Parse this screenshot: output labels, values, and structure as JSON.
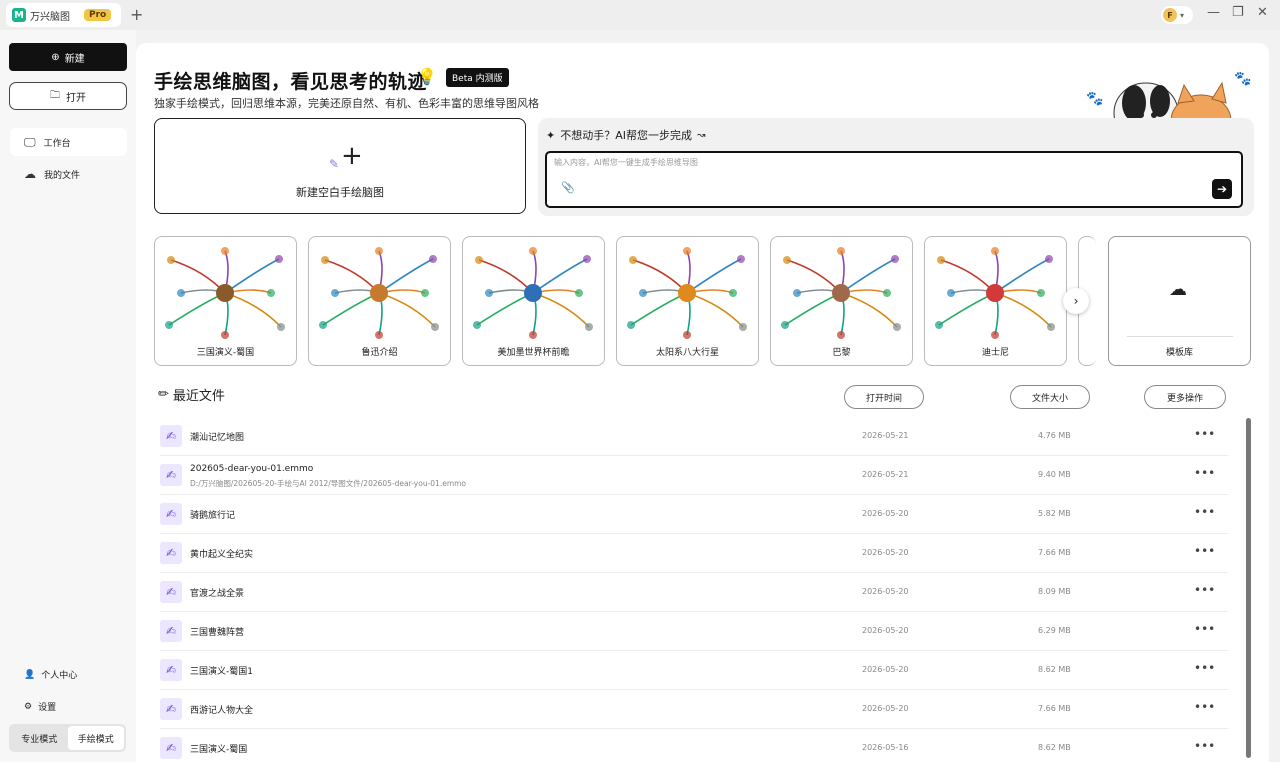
{
  "titlebar": {
    "app_name": "万兴脑图",
    "pro_badge": "Pro",
    "new_tab": "+",
    "user_initial": "F",
    "minimize": "—",
    "maximize": "❐",
    "close": "✕"
  },
  "sidebar": {
    "new_label": "新建",
    "open_label": "打开",
    "nav": [
      {
        "label": "工作台",
        "active": true
      },
      {
        "label": "我的文件",
        "active": false
      }
    ],
    "personal_center": "个人中心",
    "settings": "设置",
    "modes": [
      {
        "label": "专业模式",
        "active": false
      },
      {
        "label": "手绘模式",
        "active": true
      }
    ]
  },
  "hero": {
    "title": "手绘思维脑图，看见思考的轨迹",
    "beta": "Beta 内测版",
    "subtitle": "独家手绘模式，回归思维本源，完美还原自然、有机、色彩丰富的思维导图风格"
  },
  "new_blank": {
    "label": "新建空白手绘脑图"
  },
  "ai": {
    "title": "不想动手？AI帮您一步完成",
    "placeholder": "输入内容，AI帮您一键生成手绘思维导图"
  },
  "templates": [
    {
      "label": "三国演义-蜀国",
      "accent": "#8b5a2b"
    },
    {
      "label": "鲁迅介绍",
      "accent": "#c77a2e"
    },
    {
      "label": "美加墨世界杯前瞻",
      "accent": "#2f6fb5"
    },
    {
      "label": "太阳系八大行星",
      "accent": "#e08a1e"
    },
    {
      "label": "巴黎",
      "accent": "#a06a4a"
    },
    {
      "label": "迪士尼",
      "accent": "#d23a3a"
    }
  ],
  "template_library": "模板库",
  "recent": {
    "title": "最近文件",
    "col_open_time": "打开时间",
    "col_file_size": "文件大小",
    "col_more": "更多操作",
    "files": [
      {
        "name": "潮汕记忆地图",
        "path": "",
        "date": "2026-05-21",
        "size": "4.76 MB"
      },
      {
        "name": "202605-dear-you-01.emmo",
        "path": "D:/万兴脑图/202605-20-手绘与AI 2012/导图文件/202605-dear-you-01.emmo",
        "date": "2026-05-21",
        "size": "9.40 MB"
      },
      {
        "name": "骑鹅旅行记",
        "path": "",
        "date": "2026-05-20",
        "size": "5.82 MB"
      },
      {
        "name": "黄巾起义全纪实",
        "path": "",
        "date": "2026-05-20",
        "size": "7.66 MB"
      },
      {
        "name": "官渡之战全景",
        "path": "",
        "date": "2026-05-20",
        "size": "8.09 MB"
      },
      {
        "name": "三国曹魏阵营",
        "path": "",
        "date": "2026-05-20",
        "size": "6.29 MB"
      },
      {
        "name": "三国演义-蜀国1",
        "path": "",
        "date": "2026-05-20",
        "size": "8.62 MB"
      },
      {
        "name": "西游记人物大全",
        "path": "",
        "date": "2026-05-20",
        "size": "7.66 MB"
      },
      {
        "name": "三国演义-蜀国",
        "path": "",
        "date": "2026-05-16",
        "size": "8.62 MB"
      }
    ]
  }
}
